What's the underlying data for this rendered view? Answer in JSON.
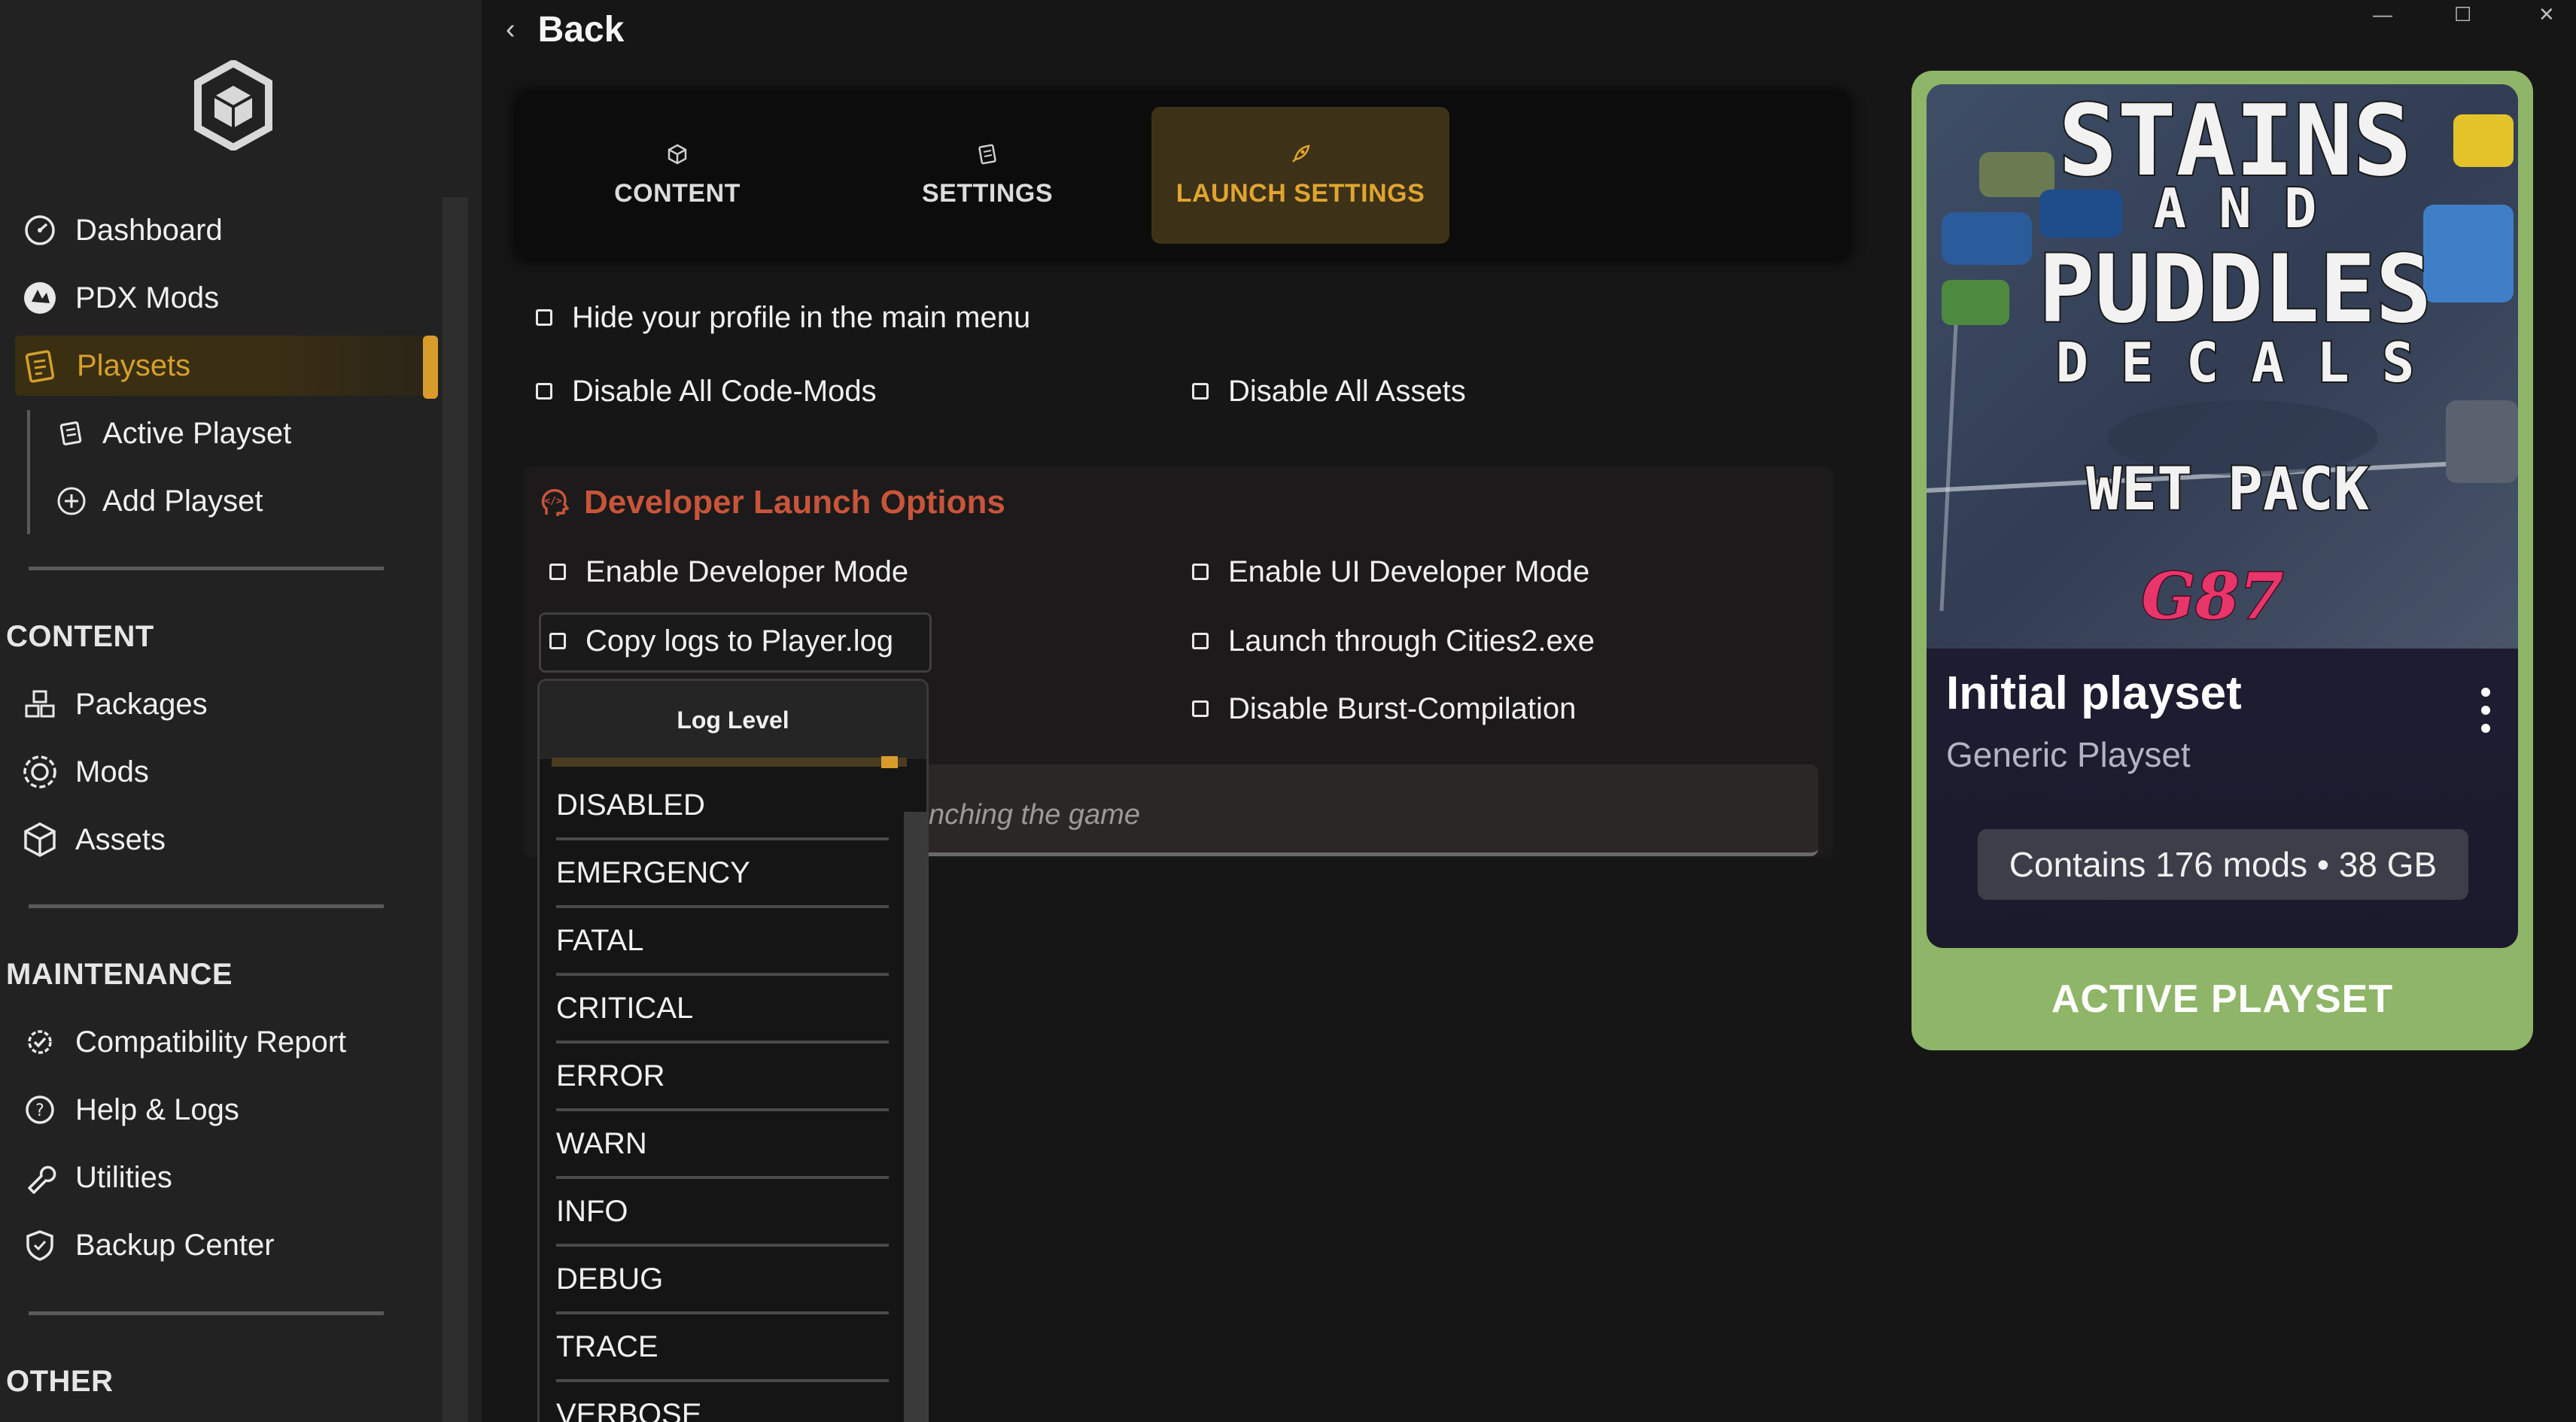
{
  "window": {
    "back_label": "Back",
    "minimize": "—",
    "maximize": "☐",
    "close": "✕"
  },
  "sidebar": {
    "logo": "hexagon-cube-logo",
    "main_items": [
      {
        "label": "Dashboard",
        "icon": "dashboard-icon"
      },
      {
        "label": "PDX Mods",
        "icon": "pdx-icon"
      },
      {
        "label": "Playsets",
        "icon": "playsets-icon",
        "active": true
      }
    ],
    "sub_items": [
      {
        "label": "Active Playset",
        "icon": "playset-icon"
      },
      {
        "label": "Add Playset",
        "icon": "add-circle-icon"
      }
    ],
    "content_heading": "CONTENT",
    "content_items": [
      {
        "label": "Packages",
        "icon": "packages-icon"
      },
      {
        "label": "Mods",
        "icon": "mods-icon"
      },
      {
        "label": "Assets",
        "icon": "assets-icon"
      }
    ],
    "maintenance_heading": "MAINTENANCE",
    "maintenance_items": [
      {
        "label": "Compatibility Report",
        "icon": "compatibility-icon"
      },
      {
        "label": "Help & Logs",
        "icon": "help-icon"
      },
      {
        "label": "Utilities",
        "icon": "wrench-icon"
      },
      {
        "label": "Backup Center",
        "icon": "backup-icon"
      }
    ],
    "other_heading": "OTHER",
    "accent": "#d99b2a"
  },
  "tabs": [
    {
      "label": "CONTENT",
      "icon": "cube-icon"
    },
    {
      "label": "SETTINGS",
      "icon": "settings-icon"
    },
    {
      "label": "LAUNCH SETTINGS",
      "icon": "rocket-icon",
      "active": true
    }
  ],
  "options": {
    "hide_profile": "Hide your profile in the main menu",
    "disable_code_mods": "Disable All Code-Mods",
    "disable_assets": "Disable All Assets"
  },
  "developer": {
    "title": "Developer Launch Options",
    "enable_dev_mode": "Enable Developer Mode",
    "enable_ui_dev_mode": "Enable UI Developer Mode",
    "copy_logs": "Copy logs to Player.log",
    "launch_through": "Launch through Cities2.exe",
    "disable_burst": "Disable Burst-Compilation",
    "hint_partial": "nching the game",
    "title_color": "#c8553a"
  },
  "log_level": {
    "header": "Log Level",
    "options": [
      "DISABLED",
      "EMERGENCY",
      "FATAL",
      "CRITICAL",
      "ERROR",
      "WARN",
      "INFO",
      "DEBUG",
      "TRACE",
      "VERBOSE"
    ]
  },
  "playset_card": {
    "image_text": {
      "line1": "STAINS",
      "line2": "A N D",
      "line3": "PUDDLES",
      "line4": "D E C A L S",
      "line5": "WET PACK",
      "signature": "G87"
    },
    "title": "Initial playset",
    "subtitle": "Generic Playset",
    "stats": "Contains 176 mods • 38 GB",
    "footer": "ACTIVE PLAYSET",
    "frame_color": "#8fb568"
  }
}
